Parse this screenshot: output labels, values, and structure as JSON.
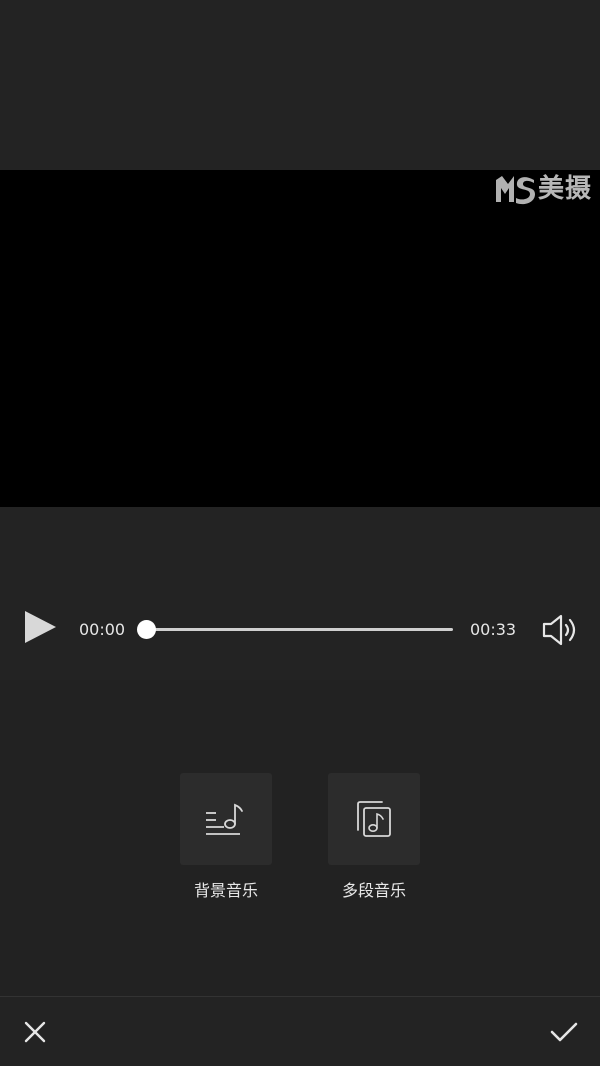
{
  "watermark": {
    "text": "美摄",
    "logo_icon": "ms-logo-icon"
  },
  "player": {
    "play_icon": "play-icon",
    "current_time": "00:00",
    "total_time": "00:33",
    "progress_fraction": 0,
    "volume_icon": "volume-icon"
  },
  "music_options": [
    {
      "label": "背景音乐",
      "icon": "background-music-icon"
    },
    {
      "label": "多段音乐",
      "icon": "multi-segment-music-icon"
    }
  ],
  "bottom_bar": {
    "cancel_icon": "close-icon",
    "confirm_icon": "check-icon"
  },
  "colors": {
    "background": "#232323",
    "video_area": "#000000",
    "tile": "#2c2c2c",
    "text": "#e8e8e8"
  }
}
